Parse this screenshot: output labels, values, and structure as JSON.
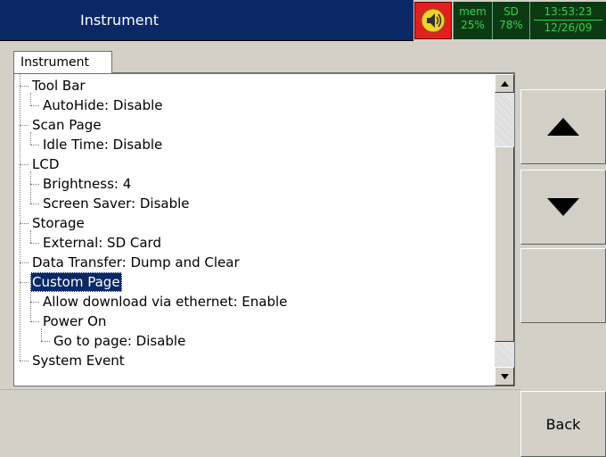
{
  "header": {
    "title": "Instrument",
    "speaker_icon": "speaker-icon",
    "mem_label": "mem",
    "mem_value": "25%",
    "sd_label": "SD",
    "sd_value": "78%",
    "time": "13:53:23",
    "date": "12/26/09"
  },
  "tab": {
    "label": "Instrument"
  },
  "tree": {
    "items": [
      {
        "label": "Tool Bar",
        "level": 0,
        "selected": false
      },
      {
        "label": "AutoHide: Disable",
        "level": 1,
        "selected": false
      },
      {
        "label": "Scan Page",
        "level": 0,
        "selected": false
      },
      {
        "label": "Idle Time: Disable",
        "level": 1,
        "selected": false
      },
      {
        "label": "LCD",
        "level": 0,
        "selected": false
      },
      {
        "label": "Brightness: 4",
        "level": 1,
        "selected": false
      },
      {
        "label": "Screen Saver: Disable",
        "level": 1,
        "selected": false
      },
      {
        "label": "Storage",
        "level": 0,
        "selected": false
      },
      {
        "label": "External: SD Card",
        "level": 1,
        "selected": false
      },
      {
        "label": "Data Transfer: Dump and Clear",
        "level": 0,
        "selected": false
      },
      {
        "label": "Custom Page",
        "level": 0,
        "selected": true
      },
      {
        "label": "Allow download via ethernet: Enable",
        "level": 1,
        "selected": false
      },
      {
        "label": "Power On",
        "level": 1,
        "selected": false
      },
      {
        "label": "Go to page: Disable",
        "level": 2,
        "selected": false
      },
      {
        "label": "System Event",
        "level": 0,
        "selected": false
      }
    ]
  },
  "scrollbar": {
    "position": 0.24,
    "visible_fraction": 0.66
  },
  "side_buttons": {
    "up_icon": "up-arrow-icon",
    "down_icon": "down-arrow-icon",
    "back_label": "Back"
  },
  "colors": {
    "title_bar": "#0a2866",
    "status_bg": "#0b3a12",
    "status_text": "#35d24e",
    "alarm": "#e02020",
    "selection": "#0a2866"
  }
}
